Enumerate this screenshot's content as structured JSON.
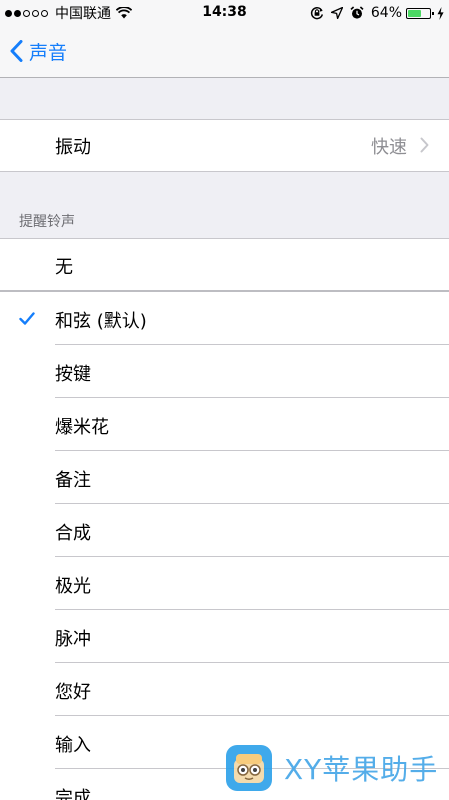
{
  "status_bar": {
    "carrier": "中国联通",
    "time": "14:38",
    "battery_percent": "64%",
    "battery_level": 0.64,
    "signal_bars_filled": 2,
    "signal_bars_total": 5,
    "icons": [
      "wifi-icon",
      "rotation-lock-icon",
      "location-arrow-icon",
      "alarm-icon",
      "charging-bolt-icon"
    ]
  },
  "nav": {
    "back_label": "声音",
    "back_icon": "chevron-left-icon"
  },
  "vibration_row": {
    "label": "振动",
    "value": "快速"
  },
  "alert_tones": {
    "header": "提醒铃声",
    "none_label": "无",
    "selected_index": 0,
    "items": [
      "和弦 (默认)",
      "按键",
      "爆米花",
      "备注",
      "合成",
      "极光",
      "脉冲",
      "您好",
      "输入",
      "完成"
    ]
  },
  "watermark": {
    "text": "XY苹果助手"
  },
  "colors": {
    "accent": "#157efb",
    "grouped_background": "#efeff4",
    "separator": "#c8c7cc",
    "secondary_text": "#8e8e93",
    "battery_fill": "#4cd964"
  }
}
